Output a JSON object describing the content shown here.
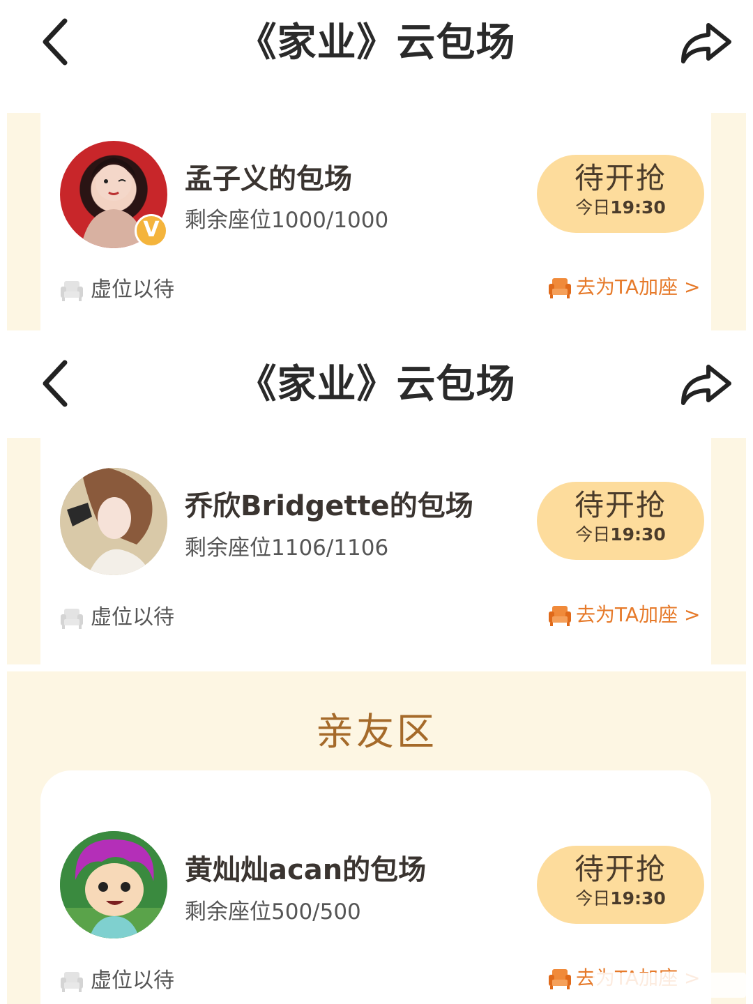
{
  "sections": [
    {
      "header": {
        "title": "《家业》云包场"
      },
      "card": {
        "name": "孟子义的包场",
        "seats": "剩余座位1000/1000",
        "status": "待开抢",
        "time_prefix": "今日",
        "time": "19:30",
        "virtual_label": "虚位以待",
        "add_seat_label": "去为TA加座 >",
        "verified_badge": "V"
      }
    },
    {
      "header": {
        "title": "《家业》云包场"
      },
      "card": {
        "name": "乔欣Bridgette的包场",
        "seats": "剩余座位1106/1106",
        "status": "待开抢",
        "time_prefix": "今日",
        "time": "19:30",
        "virtual_label": "虚位以待",
        "add_seat_label": "去为TA加座 >"
      }
    }
  ],
  "friends_zone": {
    "title": "亲友区",
    "card": {
      "name": "黄灿灿acan的包场",
      "seats": "剩余座位500/500",
      "status": "待开抢",
      "time_prefix": "今日",
      "time": "19:30",
      "virtual_label": "虚位以待",
      "add_seat_label": "去为TA加座 >"
    }
  },
  "colors": {
    "cream": "#fdf6e3",
    "pill": "#fddc9c",
    "accent_orange": "#e67a2a",
    "friends_title": "#a56a2a"
  },
  "icons": {
    "back": "chevron-left-icon",
    "share": "share-arrow-icon",
    "virtual_seat": "armchair-icon",
    "add_seat": "armchair-icon"
  }
}
